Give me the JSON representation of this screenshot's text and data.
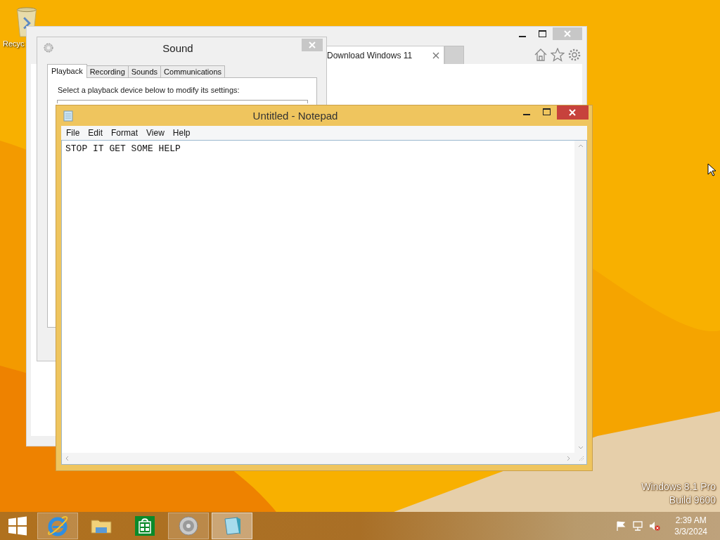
{
  "desktop": {
    "icons": [
      {
        "label": "Recyc"
      }
    ],
    "watermark": [
      "Windows 8.1 Pro",
      "Build 9600"
    ]
  },
  "browser": {
    "tabs": [
      {
        "label": "Download Windows 11",
        "selected": true
      }
    ]
  },
  "sound": {
    "title": "Sound",
    "tabs": [
      {
        "label": "Playback",
        "selected": true
      },
      {
        "label": "Recording",
        "selected": false
      },
      {
        "label": "Sounds",
        "selected": false
      },
      {
        "label": "Communications",
        "selected": false
      }
    ],
    "instruction": "Select a playback device below to modify its settings:"
  },
  "notepad": {
    "title": "Untitled - Notepad",
    "menu": [
      "File",
      "Edit",
      "Format",
      "View",
      "Help"
    ],
    "text": "STOP IT GET SOME HELP"
  },
  "taskbar": {
    "apps": [
      {
        "kind": "ie",
        "open": true,
        "selected": false
      },
      {
        "kind": "explorer",
        "open": false,
        "selected": false
      },
      {
        "kind": "store",
        "open": false,
        "selected": false
      },
      {
        "kind": "speaker",
        "open": true,
        "selected": false
      },
      {
        "kind": "notepad",
        "open": true,
        "selected": true
      }
    ],
    "tray": [
      {
        "kind": "flag"
      },
      {
        "kind": "network"
      },
      {
        "kind": "volume",
        "muted": true
      }
    ],
    "time": "2:39 AM",
    "date": "3/3/2024"
  }
}
